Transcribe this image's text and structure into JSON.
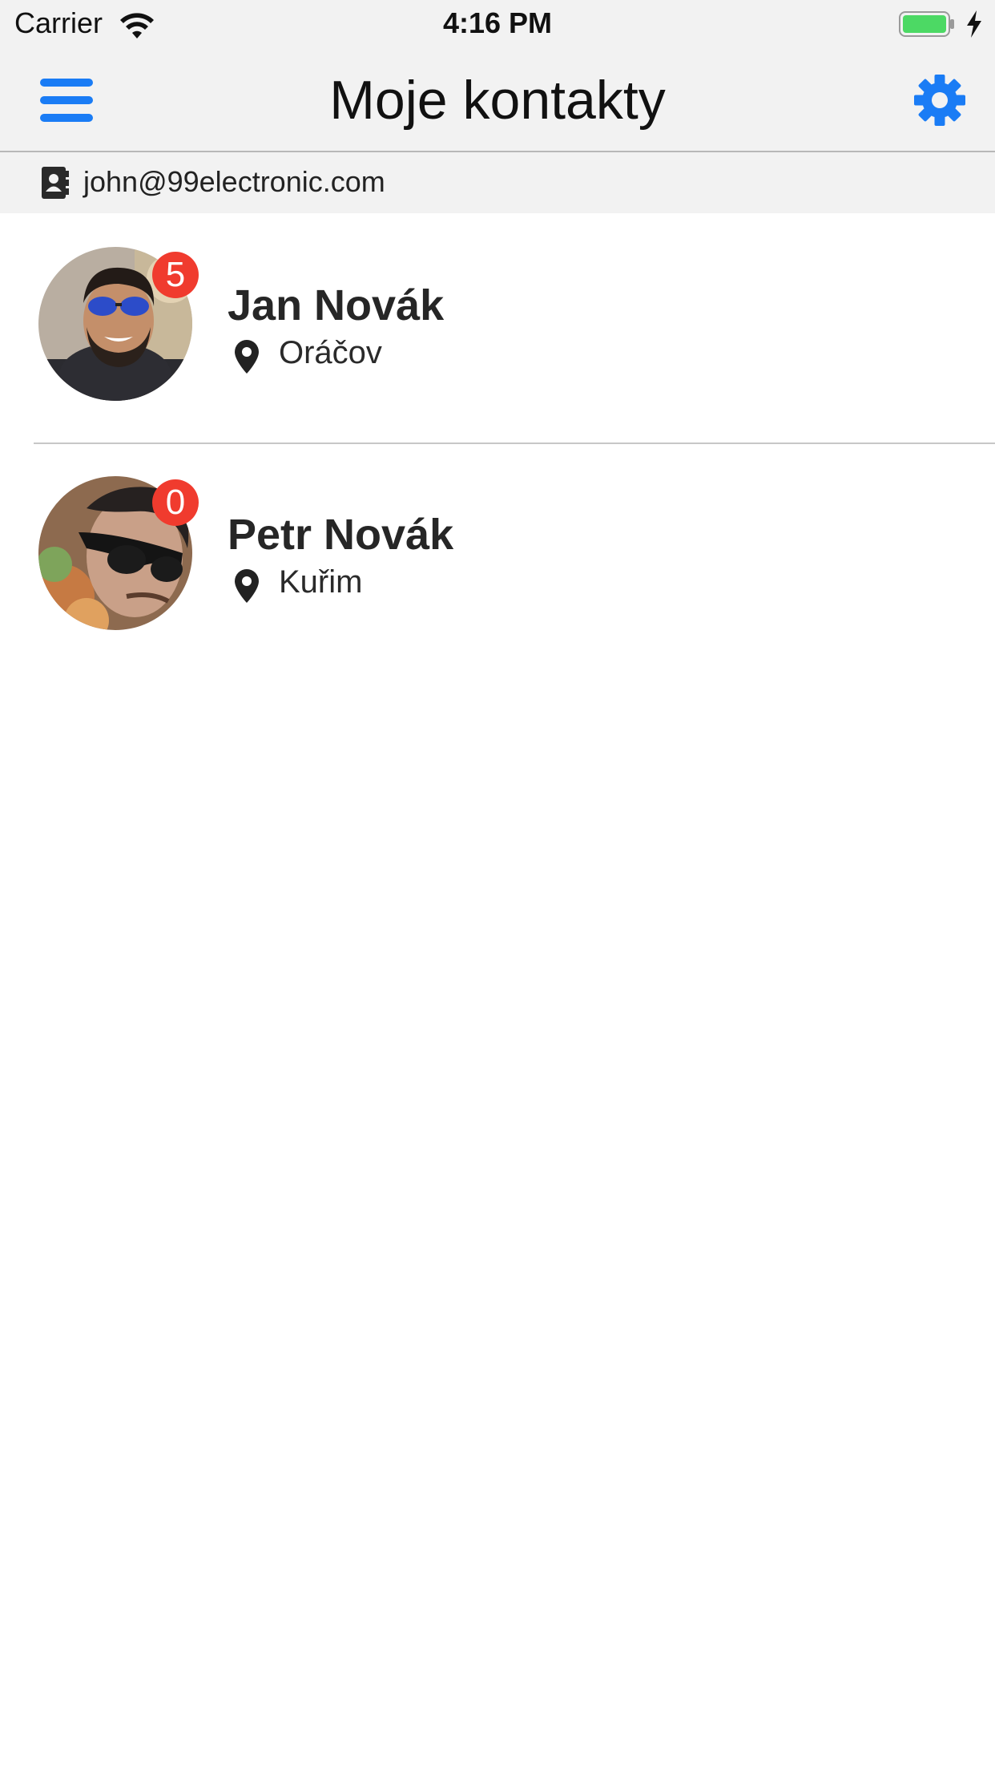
{
  "status_bar": {
    "carrier": "Carrier",
    "time": "4:16 PM",
    "battery_level": 1.0,
    "battery_color": "#4cd964"
  },
  "nav": {
    "title": "Moje kontakty",
    "accent_color": "#1a7cf5",
    "left_icon": "menu-icon",
    "right_icon": "gear-icon"
  },
  "account": {
    "icon": "contacts-book-icon",
    "email": "john@99electronic.com"
  },
  "contacts": [
    {
      "name": "Jan Novák",
      "location": "Oráčov",
      "badge": "5",
      "location_icon": "map-pin-icon"
    },
    {
      "name": "Petr Novák",
      "location": "Kuřim",
      "badge": "0",
      "location_icon": "map-pin-icon"
    }
  ]
}
